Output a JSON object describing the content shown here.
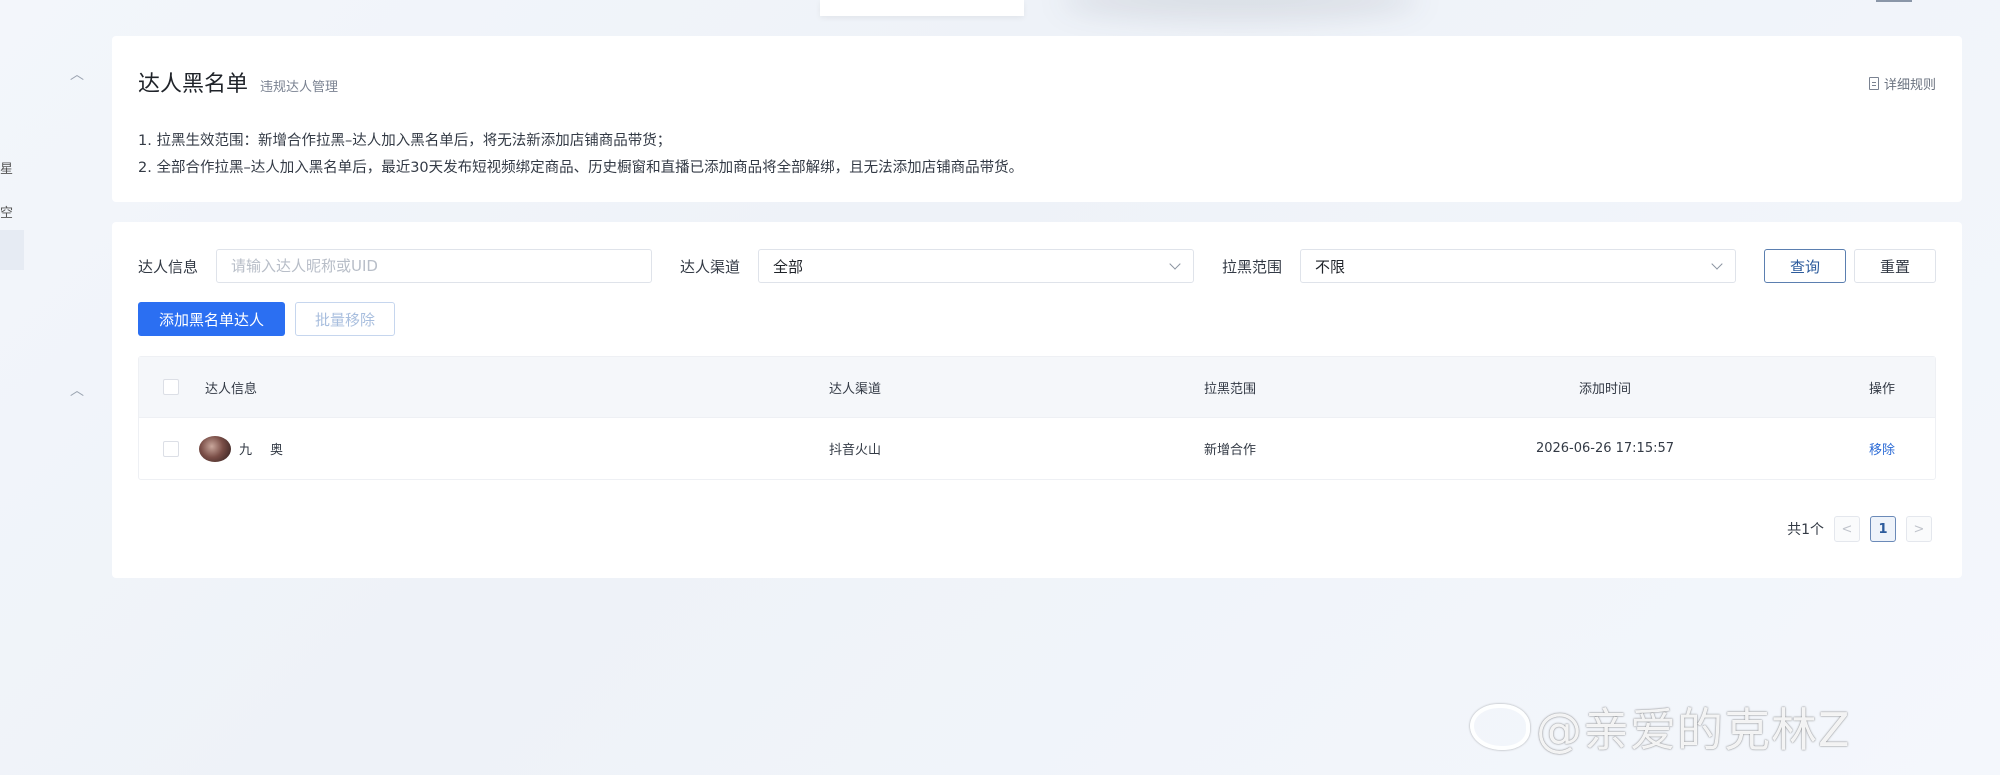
{
  "header": {
    "title": "达人黑名单",
    "subtitle": "违规达人管理",
    "rules_link": "详细规则"
  },
  "notice": {
    "line1": "1. 拉黑生效范围：新增合作拉黑–达人加入黑名单后，将无法新添加店铺商品带货；",
    "line2": "2. 全部合作拉黑–达人加入黑名单后，最近30天发布短视频绑定商品、历史橱窗和直播已添加商品将全部解绑，且无法添加店铺商品带货。"
  },
  "sidebar": {
    "chars": [
      "星",
      "空"
    ]
  },
  "filters": {
    "info_label": "达人信息",
    "info_placeholder": "请输入达人昵称或UID",
    "channel_label": "达人渠道",
    "channel_value": "全部",
    "scope_label": "拉黑范围",
    "scope_value": "不限",
    "query_button": "查询",
    "reset_button": "重置"
  },
  "actions": {
    "add_button": "添加黑名单达人",
    "batch_remove_button": "批量移除"
  },
  "table": {
    "columns": [
      "达人信息",
      "达人渠道",
      "拉黑范围",
      "添加时间",
      "操作"
    ],
    "rows": [
      {
        "name_part1": "九",
        "name_part2": "奥",
        "channel": "抖音火山",
        "scope": "新增合作",
        "time": "2026-06-26 17:15:57",
        "action": "移除"
      }
    ]
  },
  "pagination": {
    "total": "共1个",
    "current": "1",
    "prev_icon": "chevron-left-icon",
    "next_icon": "chevron-right-icon"
  },
  "watermark": {
    "text": "@亲爱的克林Z"
  }
}
